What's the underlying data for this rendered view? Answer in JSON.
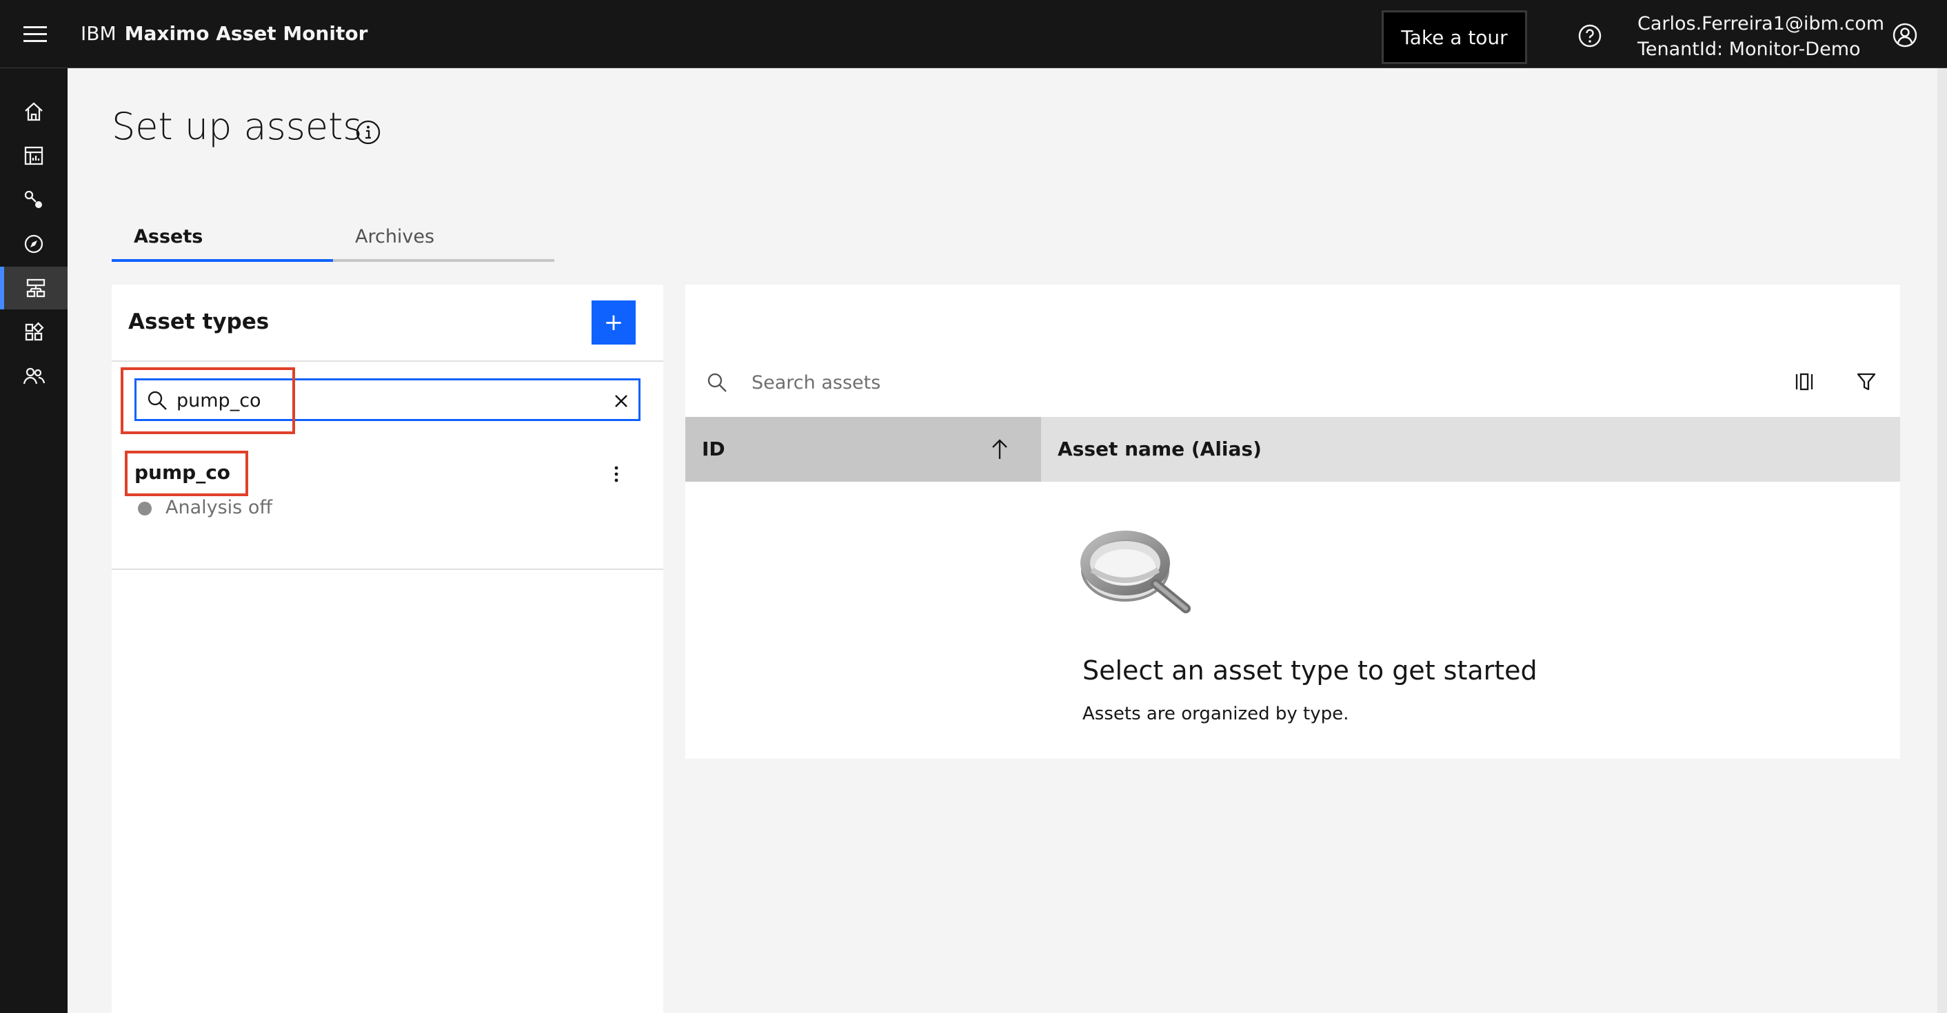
{
  "header": {
    "brand_prefix": "IBM",
    "brand_name": "Maximo Asset Monitor",
    "tour_label": "Take a tour",
    "user_email": "Carlos.Ferreira1@ibm.com",
    "tenant": "TenantId: Monitor-Demo"
  },
  "sidenav": {
    "items": [
      {
        "name": "home-icon"
      },
      {
        "name": "dashboard-icon"
      },
      {
        "name": "connect-icon"
      },
      {
        "name": "compass-icon"
      },
      {
        "name": "hierarchy-icon",
        "active": true
      },
      {
        "name": "apps-icon"
      },
      {
        "name": "users-icon"
      }
    ]
  },
  "page": {
    "title": "Set up assets"
  },
  "tabs": [
    {
      "label": "Assets",
      "active": true
    },
    {
      "label": "Archives",
      "active": false
    }
  ],
  "asset_types": {
    "title": "Asset types",
    "add_label": "+",
    "search_value": "pump_co",
    "items": [
      {
        "name": "pump_co",
        "status": "Analysis off"
      }
    ]
  },
  "assets": {
    "search_placeholder": "Search assets",
    "columns": [
      "ID",
      "Asset name (Alias)"
    ],
    "empty_title": "Select an asset type to get started",
    "empty_subtitle": "Assets are organized by type."
  },
  "colors": {
    "primary": "#0f62fe",
    "header_bg": "#161616",
    "highlight": "#e0402a"
  }
}
